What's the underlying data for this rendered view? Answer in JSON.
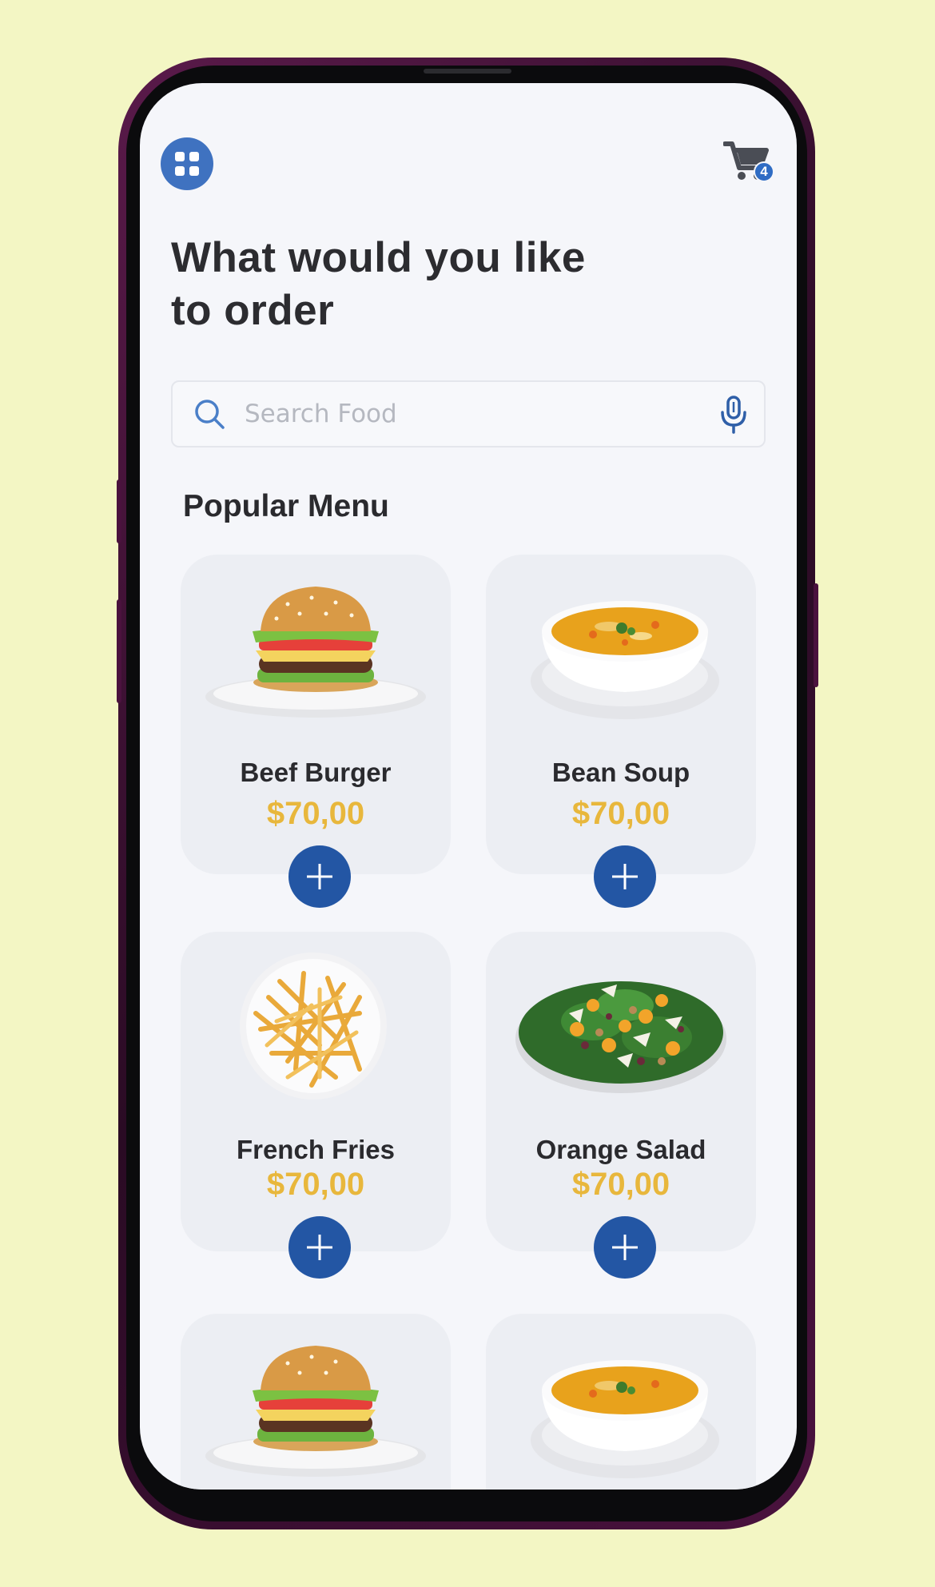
{
  "header": {
    "cart_count": "4",
    "title_line1": "What would you like",
    "title_line2": "to order"
  },
  "search": {
    "placeholder": "Search Food"
  },
  "section": {
    "title": "Popular Menu"
  },
  "menu_items": [
    {
      "name": "Beef Burger",
      "price": "$70,00",
      "image": "burger"
    },
    {
      "name": "Bean Soup",
      "price": "$70,00",
      "image": "soup"
    },
    {
      "name": "French Fries",
      "price": "$70,00",
      "image": "fries"
    },
    {
      "name": "Orange Salad",
      "price": "$70,00",
      "image": "salad"
    },
    {
      "name": "",
      "price": "",
      "image": "burger"
    },
    {
      "name": "",
      "price": "",
      "image": "soup"
    }
  ],
  "colors": {
    "background": "#f3f6c4",
    "accent": "#2356a4",
    "price": "#e8b73c",
    "card": "#eceef3"
  },
  "icons": {
    "menu": "grid-icon",
    "cart": "cart-icon",
    "search": "search-icon",
    "mic": "mic-icon",
    "add": "plus-icon"
  }
}
